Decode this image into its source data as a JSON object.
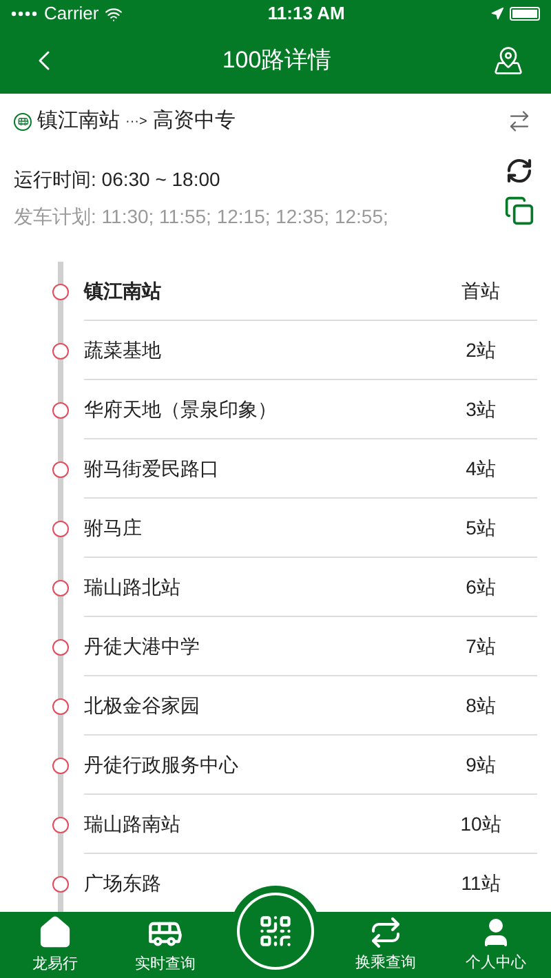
{
  "status_bar": {
    "carrier": "Carrier",
    "time": "11:13 AM"
  },
  "nav": {
    "title": "100路详情"
  },
  "route": {
    "from": "镇江南站",
    "arrow": "···>",
    "to": "高资中专"
  },
  "schedule": {
    "hours": "运行时间: 06:30 ~ 18:00",
    "departures": "发车计划: 11:30; 11:55; 12:15; 12:35; 12:55;"
  },
  "stations": [
    {
      "name": "镇江南站",
      "stop": "首站",
      "selected": true
    },
    {
      "name": "蔬菜基地",
      "stop": "2站",
      "selected": false
    },
    {
      "name": "华府天地（景泉印象）",
      "stop": "3站",
      "selected": false
    },
    {
      "name": "驸马街爱民路口",
      "stop": "4站",
      "selected": false
    },
    {
      "name": "驸马庄",
      "stop": "5站",
      "selected": false
    },
    {
      "name": "瑞山路北站",
      "stop": "6站",
      "selected": false
    },
    {
      "name": "丹徒大港中学",
      "stop": "7站",
      "selected": false
    },
    {
      "name": "北极金谷家园",
      "stop": "8站",
      "selected": false
    },
    {
      "name": "丹徒行政服务中心",
      "stop": "9站",
      "selected": false
    },
    {
      "name": "瑞山路南站",
      "stop": "10站",
      "selected": false
    },
    {
      "name": "广场东路",
      "stop": "11站",
      "selected": false
    }
  ],
  "tab_bar": [
    {
      "kind": "home",
      "label": "龙易行"
    },
    {
      "kind": "bus",
      "label": "实时查询"
    },
    {
      "kind": "scan"
    },
    {
      "kind": "transfer",
      "label": "换乘查询"
    },
    {
      "kind": "person",
      "label": "个人中心"
    }
  ]
}
